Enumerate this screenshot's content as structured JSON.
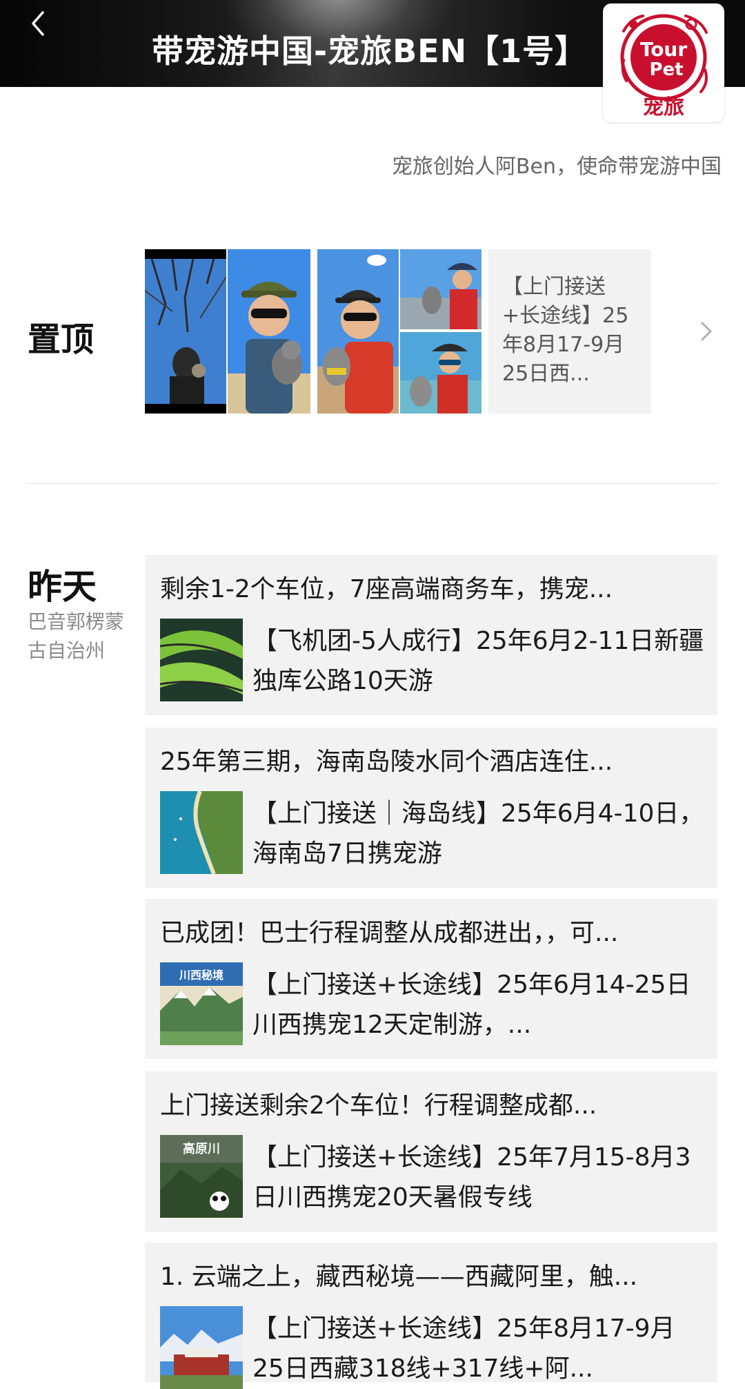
{
  "header": {
    "title": "带宠游中国-宠旅BEN【1号】",
    "logo_text_top": "Tour",
    "logo_text_mid": "Pet",
    "logo_text_bottom": "宠旅"
  },
  "subtitle": "宠旅创始人阿Ben，使命带宠游中国",
  "pinned": {
    "label": "置顶",
    "card_text": "【上门接送+长途线】25年8月17-9月25日西..."
  },
  "feed": {
    "date_label": "昨天",
    "location": "巴音郭楞蒙古自治州",
    "items": [
      {
        "headline": "剩余1-2个车位，7座高端商务车，携宠...",
        "body": "【飞机团-5人成行】25年6月2-11日新疆独库公路10天游"
      },
      {
        "headline": "25年第三期，海南岛陵水同个酒店连住...",
        "body": "【上门接送｜海岛线】25年6月4-10日，海南岛7日携宠游"
      },
      {
        "headline": "已成团！巴士行程调整从成都进出，，可...",
        "body": "【上门接送+长途线】25年6月14-25日川西携宠12天定制游，...",
        "thumb_text": "川西秘境"
      },
      {
        "headline": "上门接送剩余2个车位！行程调整成都...",
        "body": "【上门接送+长途线】25年7月15-8月3日川西携宠20天暑假专线",
        "thumb_text": "高原川"
      },
      {
        "headline": "1. 云端之上，藏西秘境——西藏阿里，触...",
        "body": "【上门接送+长途线】25年8月17-9月25日西藏318线+317线+阿..."
      }
    ]
  },
  "colors": {
    "header_bg": "#0a0a0a",
    "card_bg": "#f2f2f2",
    "brand_red": "#c8102e",
    "muted_text": "#8a8a8a"
  },
  "icons": {
    "back": "chevron-left-icon",
    "pinned_more": "chevron-right-icon"
  }
}
